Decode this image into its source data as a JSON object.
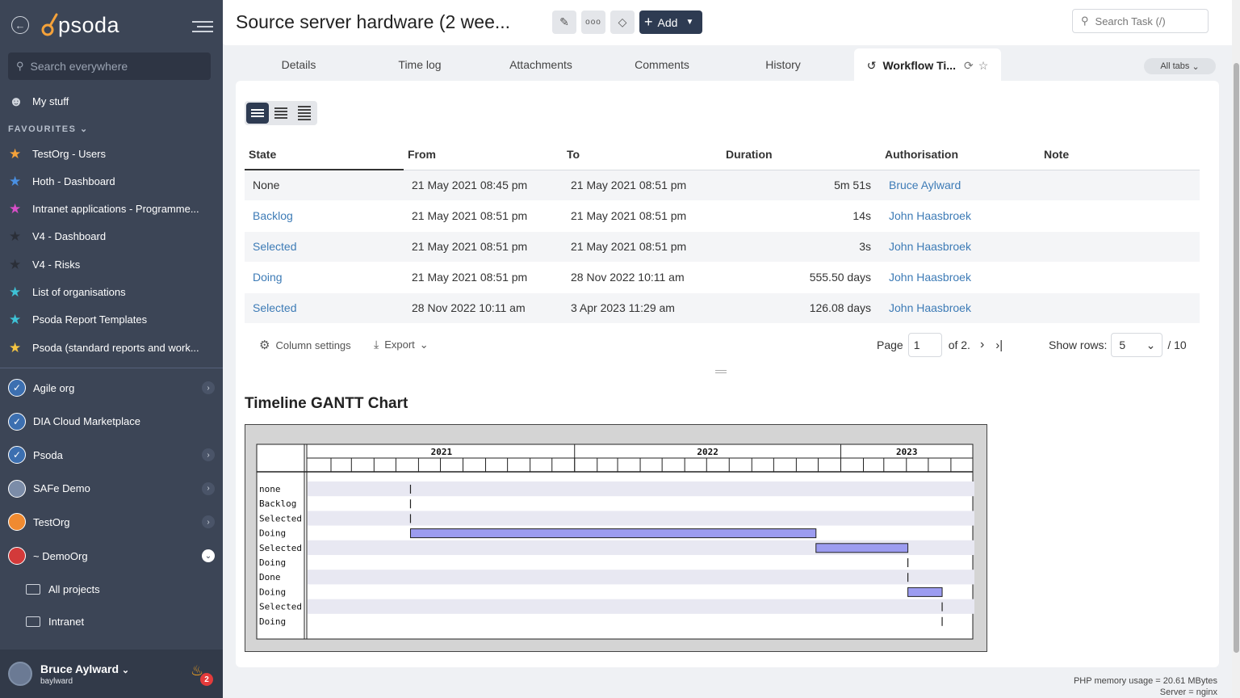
{
  "sidebar": {
    "logo": "psoda",
    "search_placeholder": "Search everywhere",
    "my_stuff": "My stuff",
    "favourites_label": "FAVOURITES",
    "favourites": [
      {
        "label": "TestOrg - Users",
        "color": "#f5a23a"
      },
      {
        "label": "Hoth - Dashboard",
        "color": "#4a90e2"
      },
      {
        "label": "Intranet applications - Programme...",
        "color": "#d94fc9"
      },
      {
        "label": "V4 - Dashboard",
        "color": "#2b2f38"
      },
      {
        "label": "V4 - Risks",
        "color": "#2b2f38"
      },
      {
        "label": "List of organisations",
        "color": "#3ec2d6"
      },
      {
        "label": "Psoda Report Templates",
        "color": "#3ec2d6"
      },
      {
        "label": "Psoda (standard reports and work...",
        "color": "#f5c542"
      }
    ],
    "orgs": [
      {
        "label": "Agile org",
        "expand": "collapsed"
      },
      {
        "label": "DIA Cloud Marketplace",
        "expand": "none"
      },
      {
        "label": "Psoda",
        "expand": "collapsed"
      },
      {
        "label": "SAFe Demo",
        "expand": "collapsed"
      },
      {
        "label": "TestOrg",
        "expand": "collapsed"
      },
      {
        "label": "~ DemoOrg",
        "expand": "expanded"
      }
    ],
    "sub_items": [
      "All projects",
      "Intranet"
    ],
    "user": {
      "name": "Bruce Aylward",
      "login": "baylward",
      "notifications": "2"
    }
  },
  "header": {
    "title": "Source server hardware (2 wee...",
    "add_label": "Add",
    "search_placeholder": "Search Task (/)"
  },
  "tabs": [
    "Details",
    "Time log",
    "Attachments",
    "Comments",
    "History",
    "Workflow Ti..."
  ],
  "all_tabs_label": "All tabs",
  "table": {
    "columns": [
      "State",
      "From",
      "To",
      "Duration",
      "Authorisation",
      "Note"
    ],
    "rows": [
      {
        "state": "None",
        "state_link": false,
        "from": "21 May 2021 08:45 pm",
        "to": "21 May 2021 08:51 pm",
        "duration": "5m 51s",
        "auth": "Bruce Aylward",
        "note": ""
      },
      {
        "state": "Backlog",
        "state_link": true,
        "from": "21 May 2021 08:51 pm",
        "to": "21 May 2021 08:51 pm",
        "duration": "14s",
        "auth": "John Haasbroek",
        "note": ""
      },
      {
        "state": "Selected",
        "state_link": true,
        "from": "21 May 2021 08:51 pm",
        "to": "21 May 2021 08:51 pm",
        "duration": "3s",
        "auth": "John Haasbroek",
        "note": ""
      },
      {
        "state": "Doing",
        "state_link": true,
        "from": "21 May 2021 08:51 pm",
        "to": "28 Nov 2022 10:11 am",
        "duration": "555.50 days",
        "auth": "John Haasbroek",
        "note": ""
      },
      {
        "state": "Selected",
        "state_link": true,
        "from": "28 Nov 2022 10:11 am",
        "to": "3 Apr 2023 11:29 am",
        "duration": "126.08 days",
        "auth": "John Haasbroek",
        "note": ""
      }
    ]
  },
  "table_footer": {
    "column_settings": "Column settings",
    "export": "Export",
    "page_label": "Page",
    "page_value": "1",
    "of_label": "of 2.",
    "show_rows_label": "Show rows:",
    "rows_value": "5",
    "total": "/ 10"
  },
  "chart_title": "Timeline GANTT Chart",
  "chart_data": {
    "type": "gantt",
    "years": [
      "2021",
      "2022",
      "2023"
    ],
    "rows": [
      {
        "label": "none",
        "start": "2021-05-21",
        "end": "2021-05-21"
      },
      {
        "label": "Backlog",
        "start": "2021-05-21",
        "end": "2021-05-21"
      },
      {
        "label": "Selected",
        "start": "2021-05-21",
        "end": "2021-05-21"
      },
      {
        "label": "Doing",
        "start": "2021-05-21",
        "end": "2022-11-28"
      },
      {
        "label": "Selected",
        "start": "2022-11-28",
        "end": "2023-04-03"
      },
      {
        "label": "Doing",
        "start": "2023-04-03",
        "end": "2023-04-03"
      },
      {
        "label": "Done",
        "start": "2023-04-03",
        "end": "2023-04-03"
      },
      {
        "label": "Doing",
        "start": "2023-04-03",
        "end": "2023-05-20"
      },
      {
        "label": "Selected",
        "start": "2023-05-20",
        "end": "2023-05-20"
      },
      {
        "label": "Doing",
        "start": "2023-05-20",
        "end": "2023-05-20"
      }
    ],
    "bar_color": "#9c9cf0",
    "row_stripe": "#e8e8f2"
  },
  "footer": {
    "memory": "PHP memory usage = 20.61 MBytes",
    "server": "Server = nginx"
  }
}
